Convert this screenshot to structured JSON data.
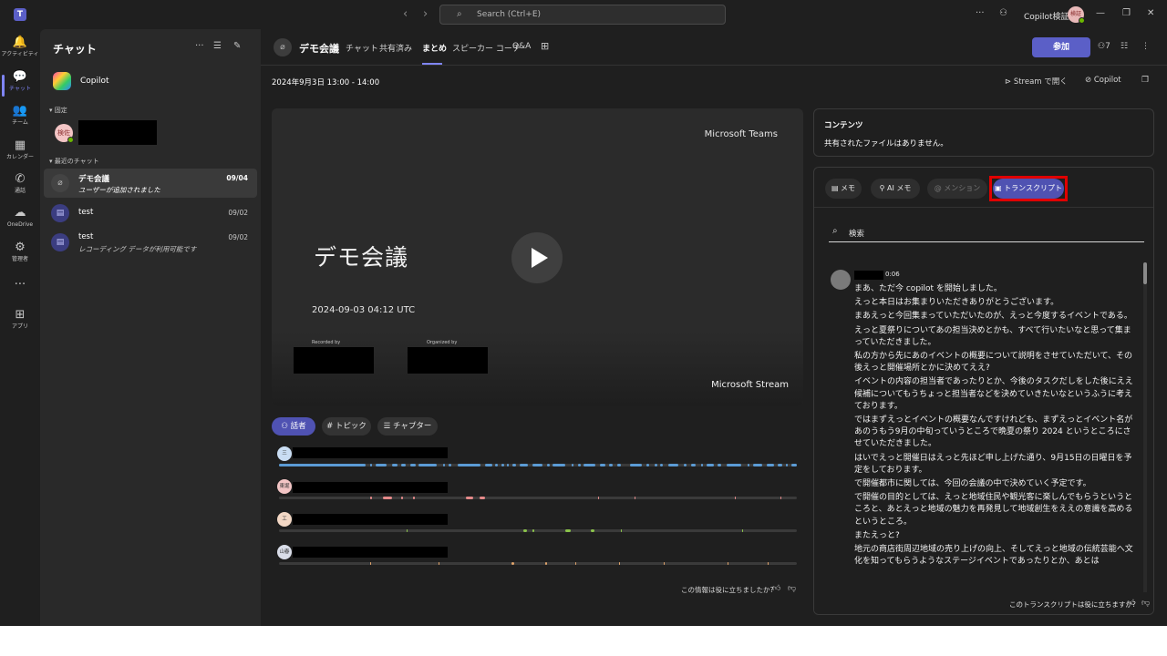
{
  "titlebar": {
    "search_placeholder": "Search (Ctrl+E)",
    "more": "···",
    "user_name": "Copilot検証",
    "user_initials": "検証"
  },
  "rail": {
    "items": [
      {
        "label": "アクティビティ",
        "icon": "bell-icon",
        "glyph": "🔔"
      },
      {
        "label": "チャット",
        "icon": "chat-icon",
        "glyph": "💬"
      },
      {
        "label": "チーム",
        "icon": "teams-icon",
        "glyph": "👥"
      },
      {
        "label": "カレンダー",
        "icon": "calendar-icon",
        "glyph": "▦"
      },
      {
        "label": "通話",
        "icon": "phone-icon",
        "glyph": "✆"
      },
      {
        "label": "OneDrive",
        "icon": "cloud-icon",
        "glyph": "☁"
      },
      {
        "label": "管理者",
        "icon": "admin-icon",
        "glyph": "⚙"
      },
      {
        "label": "",
        "icon": "more-icon",
        "glyph": "···"
      },
      {
        "label": "アプリ",
        "icon": "apps-icon",
        "glyph": "⊞"
      }
    ]
  },
  "chat_list": {
    "title": "チャット",
    "copilot": "Copilot",
    "pinned_label": "固定",
    "pinned_initials": "検佐",
    "recent_label": "最近のチャット",
    "chats": [
      {
        "name": "デモ会議",
        "preview": "ユーザーが追加されました",
        "date": "09/04"
      },
      {
        "name": "test",
        "preview": "",
        "date": "09/02"
      },
      {
        "name": "test",
        "preview": "レコーディング データが利用可能です",
        "date": "09/02"
      }
    ]
  },
  "header": {
    "title": "デモ会議",
    "tabs": [
      "チャット",
      "共有済み",
      "まとめ",
      "スピーカー コーチ",
      "Q&A"
    ],
    "active_tab": "まとめ",
    "join_label": "参加",
    "participant_count": "7",
    "date_range": "2024年9月3日 13:00 - 14:00",
    "open_stream": "Stream で開く",
    "copilot": "Copilot"
  },
  "video": {
    "brand": "Microsoft Teams",
    "title": "デモ会議",
    "date": "2024-09-03 04:12 UTC",
    "recorded_by": "Recorded by",
    "organized_by": "Organized by",
    "footer": "Microsoft Stream"
  },
  "speakers": {
    "pills": [
      "話者",
      "トピック",
      "チャプター"
    ],
    "timeline": [
      {
        "initials": "三",
        "color": "#5b9bd5",
        "avatar_bg": "#c9ddf3"
      },
      {
        "initials": "東堀",
        "color": "#e58a8a",
        "avatar_bg": "#f3c5c5"
      },
      {
        "initials": "工",
        "color": "#8bc34a",
        "avatar_bg": "#f3d8c5"
      },
      {
        "initials": "山春",
        "color": "#e0a36a",
        "avatar_bg": "#d9dde8"
      }
    ],
    "feedback": "この情報は役に立ちましたか?"
  },
  "contents": {
    "title": "コンテンツ",
    "empty": "共有されたファイルはありません。"
  },
  "transcript_panel": {
    "tabs": [
      "メモ",
      "AI メモ",
      "メンション",
      "トランスクリプト"
    ],
    "active_tab": "トランスクリプト",
    "search_placeholder": "検索",
    "timestamp": "0:06",
    "lines": [
      "まあ、ただ今 copilot を開始しました。",
      "えっと本日はお集まりいただきありがとうございます。",
      "まあえっと今回集まっていただいたのが、えっと今度するイベントである。",
      "えっと夏祭りについてあの担当決めとかも、すべて行いたいなと思って集まっていただきました。",
      "私の方から先にあのイベントの概要について説明をさせていただいて、その後えっと開催場所とかに決めてええ?",
      "イベントの内容の担当者であったりとか、今後のタスクだしをした後にええ候補についてもうちょっと担当者などを決めていきたいなというふうに考えております。",
      "ではまずえっとイベントの概要なんですけれども、まずえっとイベント名があのうもう9月の中旬っていうところで晩夏の祭り 2024 というところにさせていただきました。",
      "はいでえっと開催日はえっと先ほど申し上げた通り、9月15日の日曜日を予定をしております。",
      "で開催都市に関しては、今回の会議の中で決めていく予定です。",
      "で開催の目的としては、えっと地域住民や観光客に楽しんでもらうというところと、あとえっと地域の魅力を再発見して地域創生をええの意識を高めるというところ。",
      "またえっと?",
      "地元の商店街周辺地域の売り上げの向上、そしてえっと地域の伝統芸能へ文化を知ってもらうようなステージイベントであったりとか、あとは"
    ],
    "feedback": "このトランスクリプトは役に立ちますか?"
  }
}
